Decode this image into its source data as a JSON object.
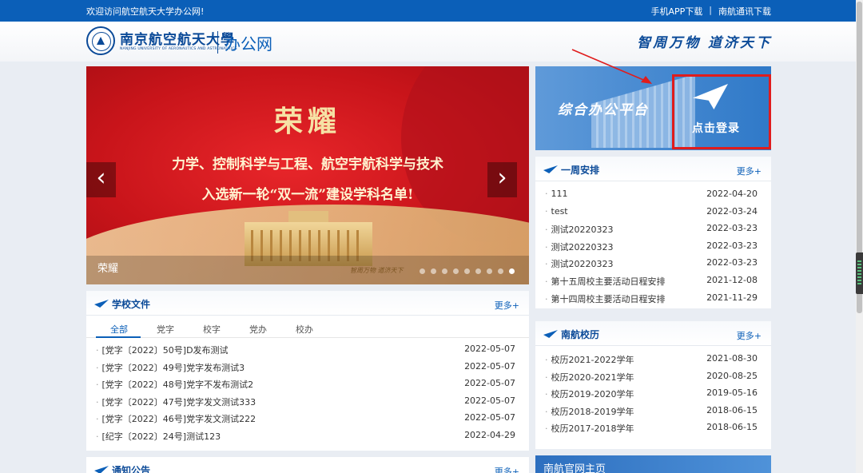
{
  "topbar": {
    "welcome": "欢迎访问航空航天大学办公网!",
    "app_download": "手机APP下载",
    "separator": "|",
    "tongxun_download": "南航通讯下载"
  },
  "header": {
    "university_name": "南京航空航天大學",
    "university_en": "NANJING UNIVERSITY OF AERONAUTICS AND ASTRONAUTICS",
    "site_name": "办公网",
    "motto": "智周万物 道济天下"
  },
  "banner": {
    "headline": "荣耀",
    "line1": "力学、控制科学与工程、航空宇航科学与技术",
    "line2": "入选新一轮“双一流”建设学科名单!",
    "mini_motto": "智周万物 道济天下",
    "caption": "荣耀",
    "prev": "‹",
    "next": "›"
  },
  "login_panel": {
    "platform_title": "综合办公平台",
    "login_label": "点击登录"
  },
  "weekly": {
    "title": "一周安排",
    "more": "更多+",
    "items": [
      {
        "title": "111",
        "date": "2022-04-20"
      },
      {
        "title": "test",
        "date": "2022-03-24"
      },
      {
        "title": "测试20220323",
        "date": "2022-03-23"
      },
      {
        "title": "测试20220323",
        "date": "2022-03-23"
      },
      {
        "title": "测试20220323",
        "date": "2022-03-23"
      },
      {
        "title": "第十五周校主要活动日程安排",
        "date": "2021-12-08"
      },
      {
        "title": "第十四周校主要活动日程安排",
        "date": "2021-11-29"
      }
    ]
  },
  "school_docs": {
    "title": "学校文件",
    "more": "更多+",
    "tabs": [
      "全部",
      "党字",
      "校字",
      "党办",
      "校办"
    ],
    "items": [
      {
        "title": "[党字〔2022〕50号]D发布测试",
        "date": "2022-05-07"
      },
      {
        "title": "[党字〔2022〕49号]党字发布测试3",
        "date": "2022-05-07"
      },
      {
        "title": "[党字〔2022〕48号]党字不发布测试2",
        "date": "2022-05-07"
      },
      {
        "title": "[党字〔2022〕47号]党字发文测试333",
        "date": "2022-05-07"
      },
      {
        "title": "[党字〔2022〕46号]党字发文测试222",
        "date": "2022-05-07"
      },
      {
        "title": "[纪字〔2022〕24号]测试123",
        "date": "2022-04-29"
      }
    ]
  },
  "calendar": {
    "title": "南航校历",
    "more": "更多+",
    "items": [
      {
        "title": "校历2021-2022学年",
        "date": "2021-08-30"
      },
      {
        "title": "校历2020-2021学年",
        "date": "2020-08-25"
      },
      {
        "title": "校历2019-2020学年",
        "date": "2019-05-16"
      },
      {
        "title": "校历2018-2019学年",
        "date": "2018-06-15"
      },
      {
        "title": "校历2017-2018学年",
        "date": "2018-06-15"
      }
    ]
  },
  "notice": {
    "title": "通知公告",
    "more": "更多+"
  },
  "bottom_banner": {
    "label": "南航官网主页"
  }
}
